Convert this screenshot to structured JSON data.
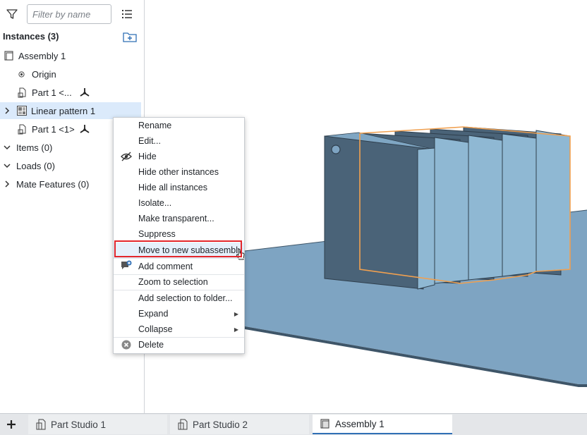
{
  "filter": {
    "placeholder": "Filter by name"
  },
  "instances": {
    "header": "Instances (3)"
  },
  "tree": [
    {
      "label": "Assembly 1"
    },
    {
      "label": "Origin"
    },
    {
      "label": "Part 1 <..."
    },
    {
      "label": "Linear pattern 1"
    },
    {
      "label": "Part 1 <1>"
    },
    {
      "label": "Items (0)"
    },
    {
      "label": "Loads (0)"
    },
    {
      "label": "Mate Features (0)"
    }
  ],
  "context_menu": {
    "items": [
      {
        "label": "Rename"
      },
      {
        "label": "Edit..."
      },
      {
        "label": "Hide",
        "icon": "eye-slash-icon"
      },
      {
        "label": "Hide other instances"
      },
      {
        "label": "Hide all instances"
      },
      {
        "label": "Isolate..."
      },
      {
        "label": "Make transparent..."
      },
      {
        "label": "Suppress"
      },
      {
        "label": "Move to new subassembly"
      },
      {
        "label": "Add comment",
        "icon": "comment-plus-icon"
      },
      {
        "label": "Zoom to selection"
      },
      {
        "label": "Add selection to folder..."
      },
      {
        "label": "Expand"
      },
      {
        "label": "Collapse"
      },
      {
        "label": "Delete",
        "icon": "delete-circle-icon"
      }
    ],
    "highlight_color": "#e3262b"
  },
  "tabs": [
    {
      "label": "Part Studio 1"
    },
    {
      "label": "Part Studio 2"
    },
    {
      "label": "Assembly 1"
    }
  ],
  "colors": {
    "selection": "#dbeafb",
    "accent": "#2f6fb5",
    "part_face": "#4a6378",
    "part_side": "#8fb8d3",
    "plate": "#7ea4c2",
    "selection_outline": "#f0a050"
  }
}
